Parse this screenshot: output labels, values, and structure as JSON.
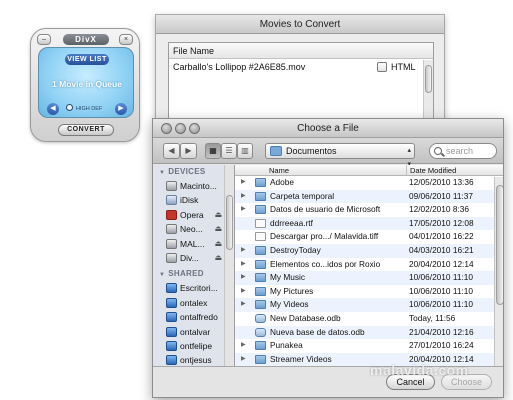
{
  "divx": {
    "logo": "DivX",
    "view_list": "VIEW LIST",
    "queue_status": "1 Movie in Queue",
    "quality": "HIGH DEF",
    "convert": "CONVERT"
  },
  "movies_window": {
    "title": "Movies to Convert",
    "column_header": "File Name",
    "files": [
      {
        "name": "Carballo's Lollipop #2A6E85.mov",
        "html_label": "HTML",
        "html_checked": false
      }
    ]
  },
  "dialog": {
    "title": "Choose a File",
    "location": "Documentos",
    "search_placeholder": "search",
    "sidebar": {
      "devices_label": "DEVICES",
      "devices": [
        {
          "label": "Macinto...",
          "icon": "hard-disk-icon",
          "eject": false
        },
        {
          "label": "iDisk",
          "icon": "idisk-icon",
          "eject": false
        },
        {
          "label": "Opera",
          "icon": "opera-disk-icon",
          "eject": true
        },
        {
          "label": "Neo...",
          "icon": "disk-image-icon",
          "eject": true
        },
        {
          "label": "MAL...",
          "icon": "disk-image-icon",
          "eject": true
        },
        {
          "label": "Div...",
          "icon": "disk-image-icon",
          "eject": true
        }
      ],
      "shared_label": "SHARED",
      "shared": [
        {
          "label": "Escritori...",
          "icon": "network-computer-icon"
        },
        {
          "label": "ontalex",
          "icon": "network-computer-icon"
        },
        {
          "label": "ontalfredo",
          "icon": "network-computer-icon"
        },
        {
          "label": "ontalvar",
          "icon": "network-computer-icon"
        },
        {
          "label": "ontfelipe",
          "icon": "network-computer-icon"
        },
        {
          "label": "ontjesus",
          "icon": "network-computer-icon"
        }
      ]
    },
    "columns": {
      "name": "Name",
      "date": "Date Modified"
    },
    "files": [
      {
        "name": "Adobe",
        "date": "12/05/2010 13:36",
        "type": "folder"
      },
      {
        "name": "Carpeta temporal",
        "date": "09/06/2010 11:37",
        "type": "folder"
      },
      {
        "name": "Datos de usuario de Microsoft",
        "date": "12/02/2010 8:36",
        "type": "folder"
      },
      {
        "name": "ddrreeaa.rtf",
        "date": "17/05/2010 12:08",
        "type": "doc"
      },
      {
        "name": "Descargar pro.../ Malavida.tiff",
        "date": "04/01/2010 16:22",
        "type": "doc"
      },
      {
        "name": "DestroyToday",
        "date": "04/03/2010 16:21",
        "type": "folder"
      },
      {
        "name": "Elementos co...idos por Roxio",
        "date": "20/04/2010 12:14",
        "type": "folder"
      },
      {
        "name": "My Music",
        "date": "10/06/2010 11:10",
        "type": "folder"
      },
      {
        "name": "My Pictures",
        "date": "10/06/2010 11:10",
        "type": "folder"
      },
      {
        "name": "My Videos",
        "date": "10/06/2010 11:10",
        "type": "folder"
      },
      {
        "name": "New Database.odb",
        "date": "Today, 11:56",
        "type": "db"
      },
      {
        "name": "Nueva base de datos.odb",
        "date": "21/04/2010 12:16",
        "type": "db"
      },
      {
        "name": "Punakea",
        "date": "27/01/2010 16:24",
        "type": "folder"
      },
      {
        "name": "Streamer Videos",
        "date": "20/04/2010 12:14",
        "type": "folder"
      }
    ],
    "cancel": "Cancel",
    "choose": "Choose"
  },
  "watermark": "malavida.com"
}
